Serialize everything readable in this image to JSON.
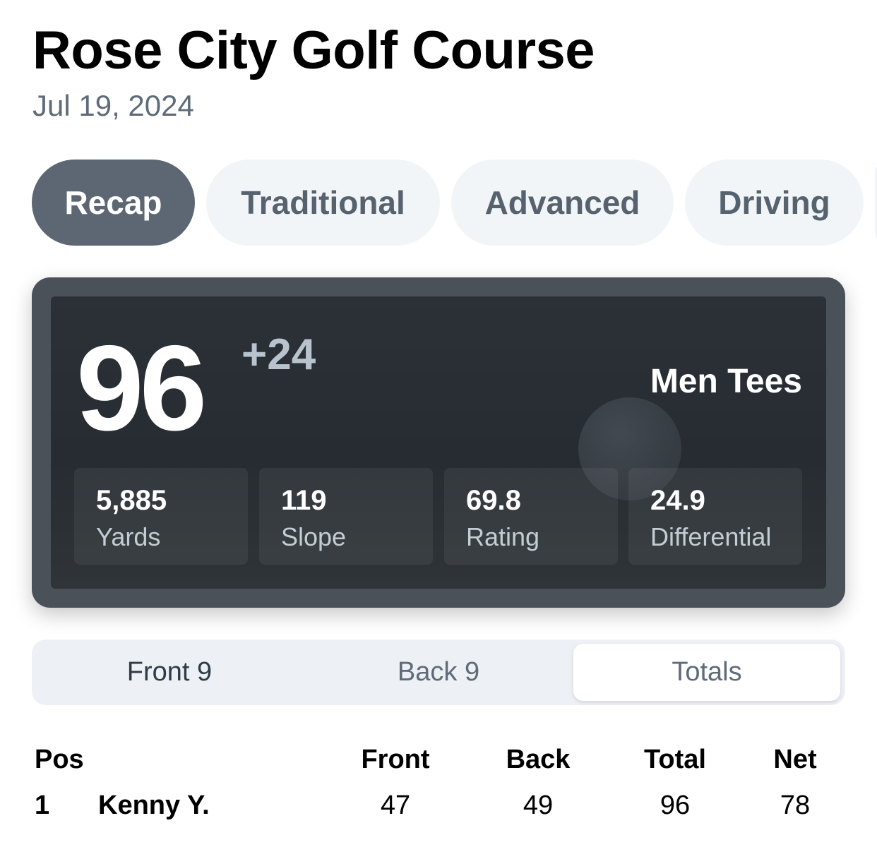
{
  "header": {
    "course_name": "Rose City Golf Course",
    "date": "Jul 19, 2024"
  },
  "tabs": [
    {
      "label": "Recap",
      "active": true
    },
    {
      "label": "Traditional",
      "active": false
    },
    {
      "label": "Advanced",
      "active": false
    },
    {
      "label": "Driving",
      "active": false
    }
  ],
  "recap": {
    "score": "96",
    "over_par": "+24",
    "tees": "Men Tees",
    "stats": [
      {
        "value": "5,885",
        "label": "Yards"
      },
      {
        "value": "119",
        "label": "Slope"
      },
      {
        "value": "69.8",
        "label": "Rating"
      },
      {
        "value": "24.9",
        "label": "Differential"
      }
    ]
  },
  "segments": {
    "options": [
      "Front 9",
      "Back 9",
      "Totals"
    ],
    "selected": "Totals"
  },
  "leaderboard": {
    "columns": {
      "pos": "Pos",
      "front": "Front",
      "back": "Back",
      "total": "Total",
      "net": "Net"
    },
    "rows": [
      {
        "pos": "1",
        "name": "Kenny Y.",
        "front": "47",
        "back": "49",
        "total": "96",
        "net": "78"
      }
    ]
  },
  "colors": {
    "active_tab": "#5c6773",
    "inactive_tab": "#f2f5f8",
    "card_frame": "#4a5158",
    "secondary_text": "#5e6b78"
  }
}
